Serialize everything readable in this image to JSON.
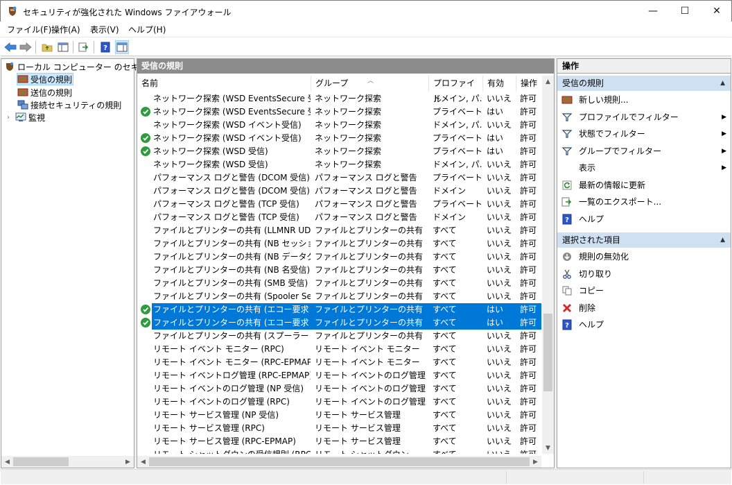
{
  "window": {
    "title": "セキュリティが強化された Windows ファイアウォール",
    "minimize": "—",
    "maximize": "☐",
    "close": "✕"
  },
  "menu": [
    "ファイル(F)",
    "操作(A)",
    "表示(V)",
    "ヘルプ(H)"
  ],
  "tree": {
    "root": "ローカル コンピューター のセキュリティ",
    "items": [
      "受信の規則",
      "送信の規則",
      "接続セキュリティの規則",
      "監視"
    ]
  },
  "middle": {
    "header": "受信の規則",
    "columns": [
      "名前",
      "グループ",
      "プロファイル",
      "有効",
      "操作"
    ],
    "rows": [
      {
        "enabled_icon": false,
        "selected": false,
        "name": "ネットワーク探索 (WSD EventsSecure 受信)",
        "group": "ネットワーク探索",
        "profile": "ドメイン, パ...",
        "enabled": "いいえ",
        "action": "許可"
      },
      {
        "enabled_icon": true,
        "selected": false,
        "name": "ネットワーク探索 (WSD EventsSecure 受信)",
        "group": "ネットワーク探索",
        "profile": "プライベート",
        "enabled": "はい",
        "action": "許可"
      },
      {
        "enabled_icon": false,
        "selected": false,
        "name": "ネットワーク探索 (WSD イベント受信)",
        "group": "ネットワーク探索",
        "profile": "ドメイン, パ...",
        "enabled": "いいえ",
        "action": "許可"
      },
      {
        "enabled_icon": true,
        "selected": false,
        "name": "ネットワーク探索 (WSD イベント受信)",
        "group": "ネットワーク探索",
        "profile": "プライベート",
        "enabled": "はい",
        "action": "許可"
      },
      {
        "enabled_icon": true,
        "selected": false,
        "name": "ネットワーク探索 (WSD 受信)",
        "group": "ネットワーク探索",
        "profile": "プライベート",
        "enabled": "はい",
        "action": "許可"
      },
      {
        "enabled_icon": false,
        "selected": false,
        "name": "ネットワーク探索 (WSD 受信)",
        "group": "ネットワーク探索",
        "profile": "ドメイン, パ...",
        "enabled": "いいえ",
        "action": "許可"
      },
      {
        "enabled_icon": false,
        "selected": false,
        "name": "パフォーマンス ログと警告 (DCOM 受信)",
        "group": "パフォーマンス ログと警告",
        "profile": "プライベート,...",
        "enabled": "いいえ",
        "action": "許可"
      },
      {
        "enabled_icon": false,
        "selected": false,
        "name": "パフォーマンス ログと警告 (DCOM 受信)",
        "group": "パフォーマンス ログと警告",
        "profile": "ドメイン",
        "enabled": "いいえ",
        "action": "許可"
      },
      {
        "enabled_icon": false,
        "selected": false,
        "name": "パフォーマンス ログと警告 (TCP 受信)",
        "group": "パフォーマンス ログと警告",
        "profile": "プライベート,...",
        "enabled": "いいえ",
        "action": "許可"
      },
      {
        "enabled_icon": false,
        "selected": false,
        "name": "パフォーマンス ログと警告 (TCP 受信)",
        "group": "パフォーマンス ログと警告",
        "profile": "ドメイン",
        "enabled": "いいえ",
        "action": "許可"
      },
      {
        "enabled_icon": false,
        "selected": false,
        "name": "ファイルとプリンターの共有 (LLMNR UDP 受信)",
        "group": "ファイルとプリンターの共有",
        "profile": "すべて",
        "enabled": "いいえ",
        "action": "許可"
      },
      {
        "enabled_icon": false,
        "selected": false,
        "name": "ファイルとプリンターの共有 (NB セッション受信)",
        "group": "ファイルとプリンターの共有",
        "profile": "すべて",
        "enabled": "いいえ",
        "action": "許可"
      },
      {
        "enabled_icon": false,
        "selected": false,
        "name": "ファイルとプリンターの共有 (NB データグラム受信)",
        "group": "ファイルとプリンターの共有",
        "profile": "すべて",
        "enabled": "いいえ",
        "action": "許可"
      },
      {
        "enabled_icon": false,
        "selected": false,
        "name": "ファイルとプリンターの共有 (NB 名受信)",
        "group": "ファイルとプリンターの共有",
        "profile": "すべて",
        "enabled": "いいえ",
        "action": "許可"
      },
      {
        "enabled_icon": false,
        "selected": false,
        "name": "ファイルとプリンターの共有 (SMB 受信)",
        "group": "ファイルとプリンターの共有",
        "profile": "すべて",
        "enabled": "いいえ",
        "action": "許可"
      },
      {
        "enabled_icon": false,
        "selected": false,
        "name": "ファイルとプリンターの共有 (Spooler Service - ...",
        "group": "ファイルとプリンターの共有",
        "profile": "すべて",
        "enabled": "いいえ",
        "action": "許可"
      },
      {
        "enabled_icon": true,
        "selected": true,
        "name": "ファイルとプリンターの共有 (エコー要求 - ICMP...",
        "group": "ファイルとプリンターの共有",
        "profile": "すべて",
        "enabled": "はい",
        "action": "許可"
      },
      {
        "enabled_icon": true,
        "selected": true,
        "name": "ファイルとプリンターの共有 (エコー要求 - ICMP...",
        "group": "ファイルとプリンターの共有",
        "profile": "すべて",
        "enabled": "はい",
        "action": "許可"
      },
      {
        "enabled_icon": false,
        "selected": false,
        "name": "ファイルとプリンターの共有 (スプーラー サービス - ...",
        "group": "ファイルとプリンターの共有",
        "profile": "すべて",
        "enabled": "いいえ",
        "action": "許可"
      },
      {
        "enabled_icon": false,
        "selected": false,
        "name": "リモート イベント モニター (RPC)",
        "group": "リモート イベント モニター",
        "profile": "すべて",
        "enabled": "いいえ",
        "action": "許可"
      },
      {
        "enabled_icon": false,
        "selected": false,
        "name": "リモート イベント モニター (RPC-EPMAP)",
        "group": "リモート イベント モニター",
        "profile": "すべて",
        "enabled": "いいえ",
        "action": "許可"
      },
      {
        "enabled_icon": false,
        "selected": false,
        "name": "リモート イベントログ管理 (RPC-EPMAP)",
        "group": "リモート イベントのログ管理",
        "profile": "すべて",
        "enabled": "いいえ",
        "action": "許可"
      },
      {
        "enabled_icon": false,
        "selected": false,
        "name": "リモート イベントのログ管理 (NP 受信)",
        "group": "リモート イベントのログ管理",
        "profile": "すべて",
        "enabled": "いいえ",
        "action": "許可"
      },
      {
        "enabled_icon": false,
        "selected": false,
        "name": "リモート イベントのログ管理 (RPC)",
        "group": "リモート イベントのログ管理",
        "profile": "すべて",
        "enabled": "いいえ",
        "action": "許可"
      },
      {
        "enabled_icon": false,
        "selected": false,
        "name": "リモート サービス管理 (NP 受信)",
        "group": "リモート サービス管理",
        "profile": "すべて",
        "enabled": "いいえ",
        "action": "許可"
      },
      {
        "enabled_icon": false,
        "selected": false,
        "name": "リモート サービス管理 (RPC)",
        "group": "リモート サービス管理",
        "profile": "すべて",
        "enabled": "いいえ",
        "action": "許可"
      },
      {
        "enabled_icon": false,
        "selected": false,
        "name": "リモート サービス管理 (RPC-EPMAP)",
        "group": "リモート サービス管理",
        "profile": "すべて",
        "enabled": "いいえ",
        "action": "許可"
      },
      {
        "enabled_icon": false,
        "selected": false,
        "name": "リモート シャットダウンの受信規則 (RPC-EP 受...",
        "group": "リモート シャットダウン",
        "profile": "すべて",
        "enabled": "いいえ",
        "action": "許可"
      }
    ]
  },
  "actions": {
    "title": "操作",
    "section1": "受信の規則",
    "section1_items": [
      {
        "label": "新しい規則...",
        "icon": "new-rule-icon",
        "submenu": false
      },
      {
        "label": "プロファイルでフィルター",
        "icon": "filter-icon",
        "submenu": true
      },
      {
        "label": "状態でフィルター",
        "icon": "filter-icon",
        "submenu": true
      },
      {
        "label": "グループでフィルター",
        "icon": "filter-icon",
        "submenu": true
      },
      {
        "label": "表示",
        "icon": "",
        "submenu": true
      },
      {
        "label": "最新の情報に更新",
        "icon": "refresh-icon",
        "submenu": false
      },
      {
        "label": "一覧のエクスポート...",
        "icon": "export-icon",
        "submenu": false
      },
      {
        "label": "ヘルプ",
        "icon": "help-icon",
        "submenu": false
      }
    ],
    "section2": "選択された項目",
    "section2_items": [
      {
        "label": "規則の無効化",
        "icon": "disable-icon"
      },
      {
        "label": "切り取り",
        "icon": "cut-icon"
      },
      {
        "label": "コピー",
        "icon": "copy-icon"
      },
      {
        "label": "削除",
        "icon": "delete-icon"
      },
      {
        "label": "ヘルプ",
        "icon": "help-icon"
      }
    ]
  },
  "colors": {
    "selection": "#0078d7",
    "section_header": "#cfe0f3",
    "pane_header": "#8c8c8c",
    "enabled_check": "#2e9b3e"
  }
}
